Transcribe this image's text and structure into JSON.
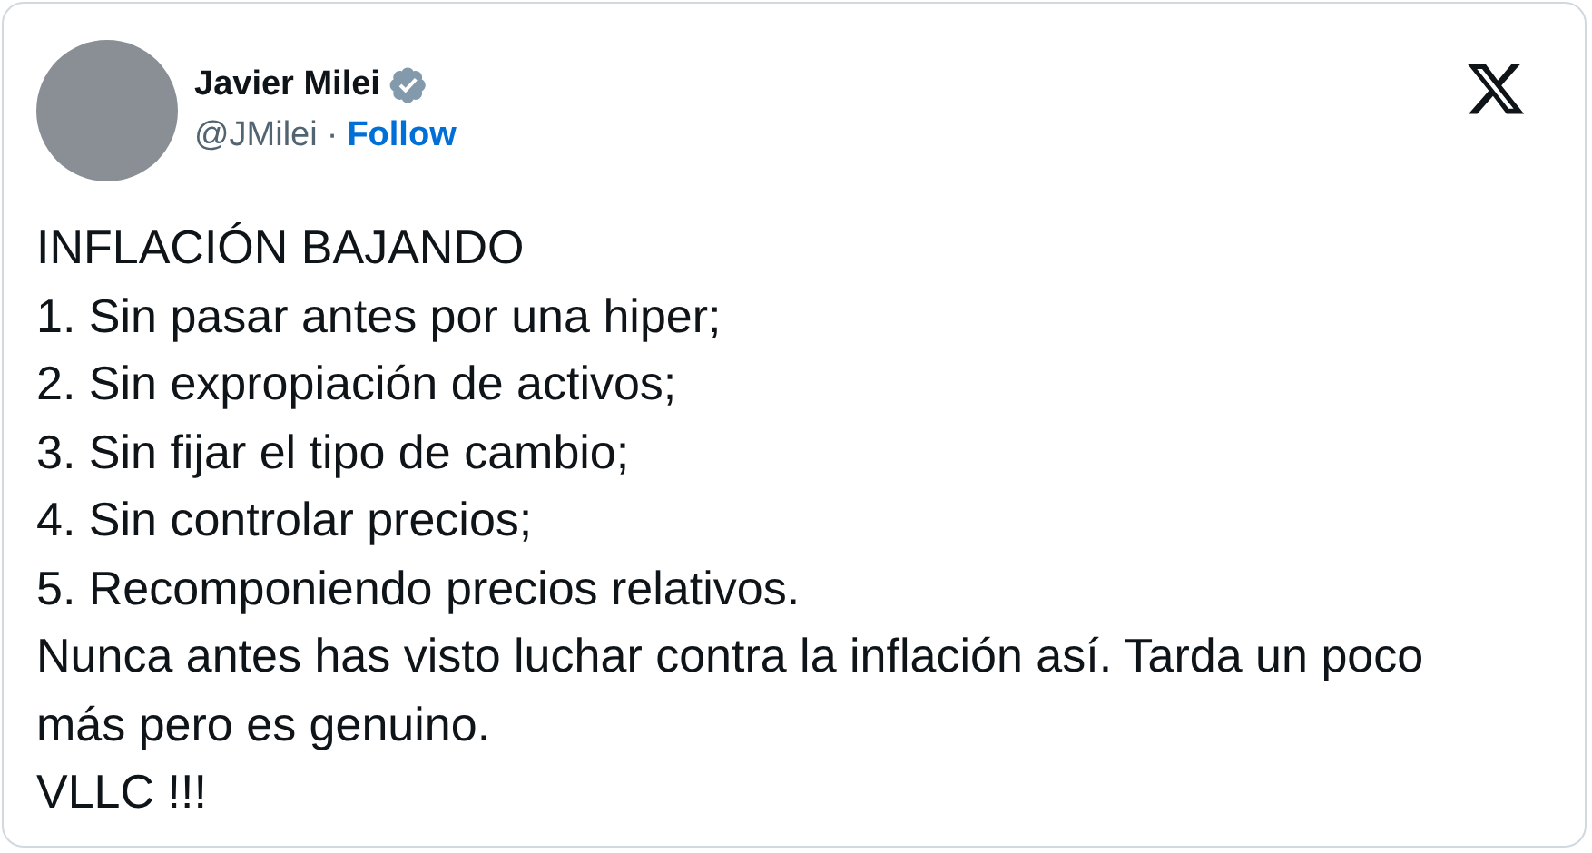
{
  "author": {
    "name": "Javier Milei",
    "verified": true,
    "handle": "@JMilei",
    "separator": "·",
    "follow": "Follow"
  },
  "body": [
    "INFLACIÓN BAJANDO",
    "1. Sin pasar antes por una hiper;",
    "2. Sin expropiación de activos;",
    "3. Sin fijar el tipo de cambio;",
    "4. Sin controlar precios;",
    "5. Recomponiendo precios relativos.",
    "Nunca antes has visto luchar contra la inflación así. Tarda un poco más pero es genuino.",
    "VLLC !!!"
  ]
}
